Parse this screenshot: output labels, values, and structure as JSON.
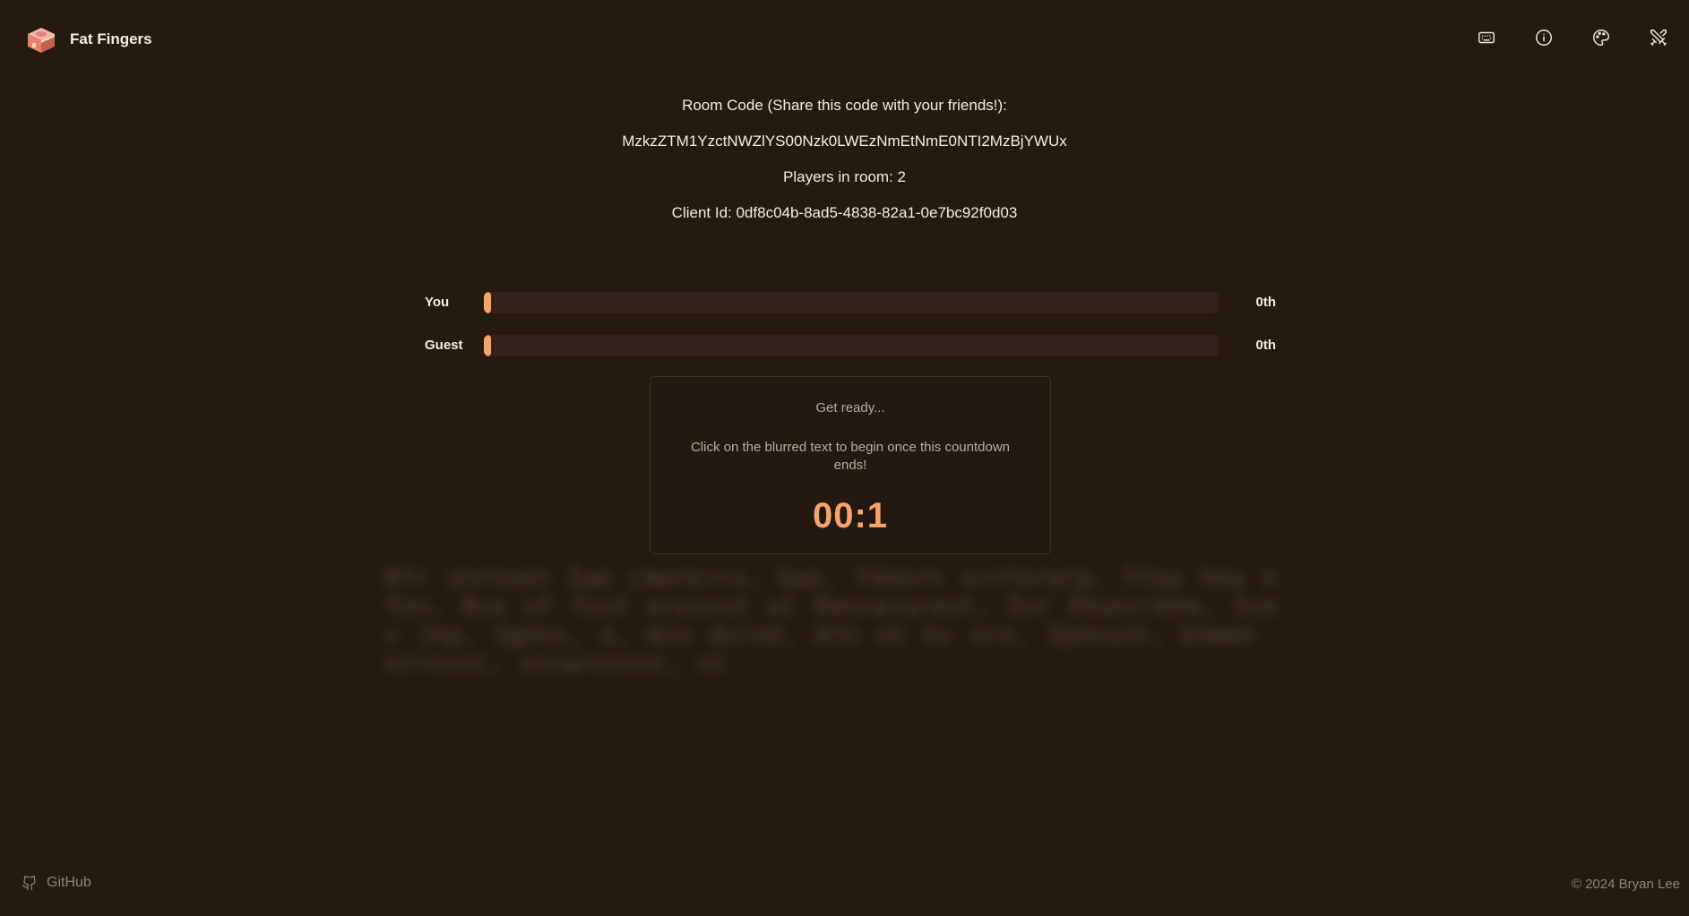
{
  "app": {
    "name": "Fat Fingers"
  },
  "header": {
    "icons": [
      "keyboard-icon",
      "info-icon",
      "palette-icon",
      "swords-icon"
    ]
  },
  "room": {
    "code_label": "Room Code (Share this code with your friends!):",
    "code": "MzkzZTM1YzctNWZlYS00Nzk0LWEzNmEtNmE0NTI2MzBjYWUx",
    "players": "Players in room: 2",
    "client_id": "Client Id: 0df8c04b-8ad5-4838-82a1-0e7bc92f0d03"
  },
  "race": {
    "players": [
      {
        "name": "You",
        "place": "0th",
        "progress": 0
      },
      {
        "name": "Guest",
        "place": "0th",
        "progress": 0
      }
    ]
  },
  "countdown": {
    "title": "Get ready...",
    "message": "Click on the blurred text to begin once this countdown ends!",
    "timer": "00:1"
  },
  "footer": {
    "github_label": "GitHub",
    "copyright": "© 2024 Bryan Lee"
  },
  "colors": {
    "background": "#251a0f",
    "accent": "#f5a46a",
    "track": "#36201d"
  }
}
